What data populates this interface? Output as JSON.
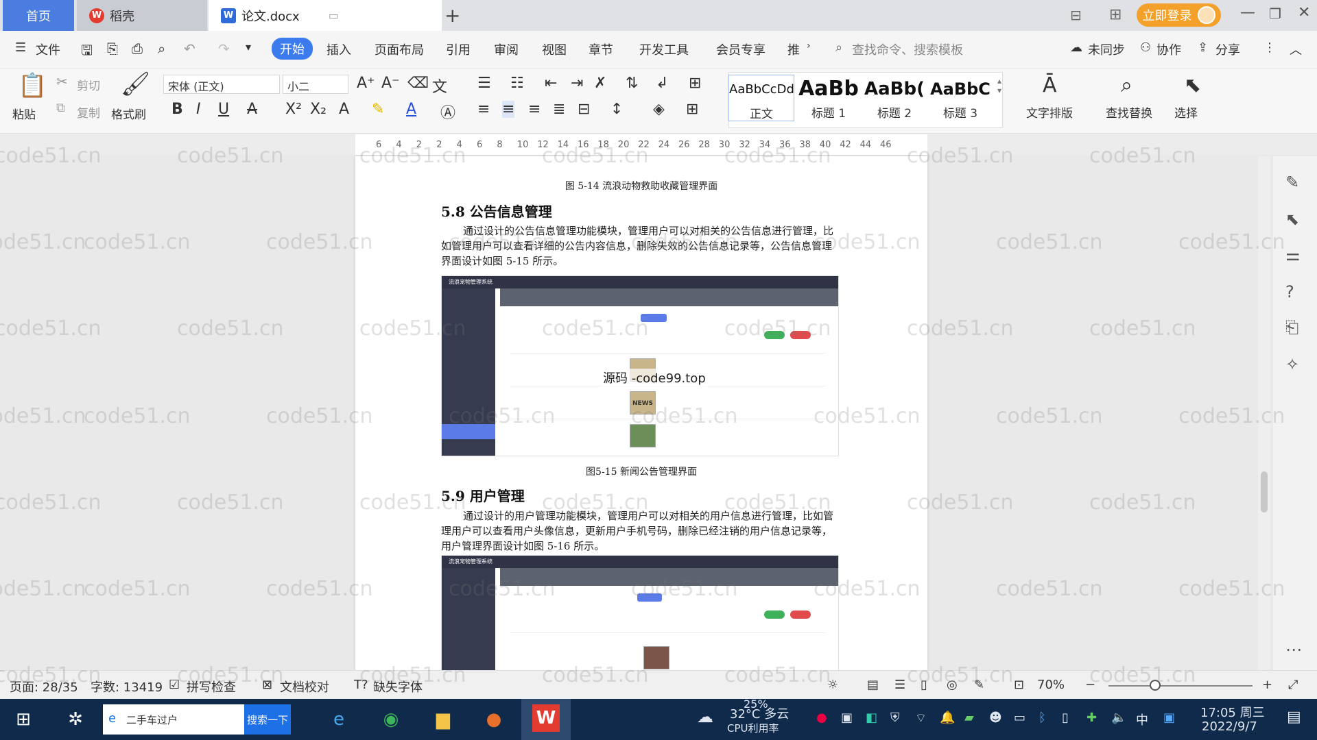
{
  "tabs": {
    "home": "首页",
    "daoke": "稻壳",
    "doc": "论文.docx",
    "new_tab": "+"
  },
  "account": {
    "login": "立即登录"
  },
  "menu": {
    "file": "文件",
    "items": [
      "开始",
      "插入",
      "页面布局",
      "引用",
      "审阅",
      "视图",
      "章节",
      "开发工具",
      "会员专享",
      "推"
    ],
    "search_cmd": "查找命令、搜索模板",
    "sync": "未同步",
    "collab": "协作",
    "share": "分享"
  },
  "ribbon": {
    "paste": "粘贴",
    "cut": "剪切",
    "copy": "复制",
    "format_painter": "格式刷",
    "font_name": "宋体 (正文)",
    "font_size": "小二",
    "styles": [
      {
        "preview": "AaBbCcDd",
        "name": "正文"
      },
      {
        "preview": "AaBb",
        "name": "标题 1"
      },
      {
        "preview": "AaBb(",
        "name": "标题 2"
      },
      {
        "preview": "AaBbC",
        "name": "标题 3"
      }
    ],
    "text_layout": "文字排版",
    "find_replace": "查找替换",
    "select": "选择"
  },
  "ruler": [
    "6",
    "4",
    "2",
    "2",
    "4",
    "6",
    "8",
    "10",
    "12",
    "14",
    "16",
    "18",
    "20",
    "22",
    "24",
    "26",
    "28",
    "30",
    "32",
    "34",
    "36",
    "38",
    "40",
    "42",
    "44",
    "46"
  ],
  "document": {
    "caption_1": "图 5-14 流浪动物救助收藏管理界面",
    "heading_58": "5.8 公告信息管理",
    "para_58": "通过设计的公告信息管理功能模块，管理用户可以对相关的公告信息进行管理，比如管理用户可以查看详细的公告内容信息，删除失效的公告信息记录等，公告信息管理界面设计如图 5-15 所示。",
    "caption_2": "图5-15 新闻公告管理界面",
    "heading_59": "5.9 用户管理",
    "para_59": "通过设计的用户管理功能模块，管理用户可以对相关的用户信息进行管理，比如管理用户可以查看用户头像信息，更新用户手机号码，删除已经注销的用户信息记录等，用户管理界面设计如图 5-16 所示。",
    "overlay_text": "源码 -code99.top",
    "thumb_label": "NEWS",
    "screenshot_title": "流浪宠物管理系统"
  },
  "watermark": "code51.cn",
  "status": {
    "page": "页面: 28/35",
    "words": "字数: 13419",
    "spell": "拼写检查",
    "proof": "文档校对",
    "missing_font": "缺失字体",
    "zoom": "70%"
  },
  "taskbar": {
    "search_text": "二手车过户",
    "search_btn": "搜索一下",
    "cpu_percent": "25%",
    "cpu_label": "CPU利用率",
    "weather": "32°C 多云",
    "ime": "中",
    "time": "17:05 周三",
    "date": "2022/9/7"
  },
  "colors": {
    "accent": "#3c7bee",
    "login": "#f4a12b",
    "taskbar": "#0f2a4a"
  }
}
